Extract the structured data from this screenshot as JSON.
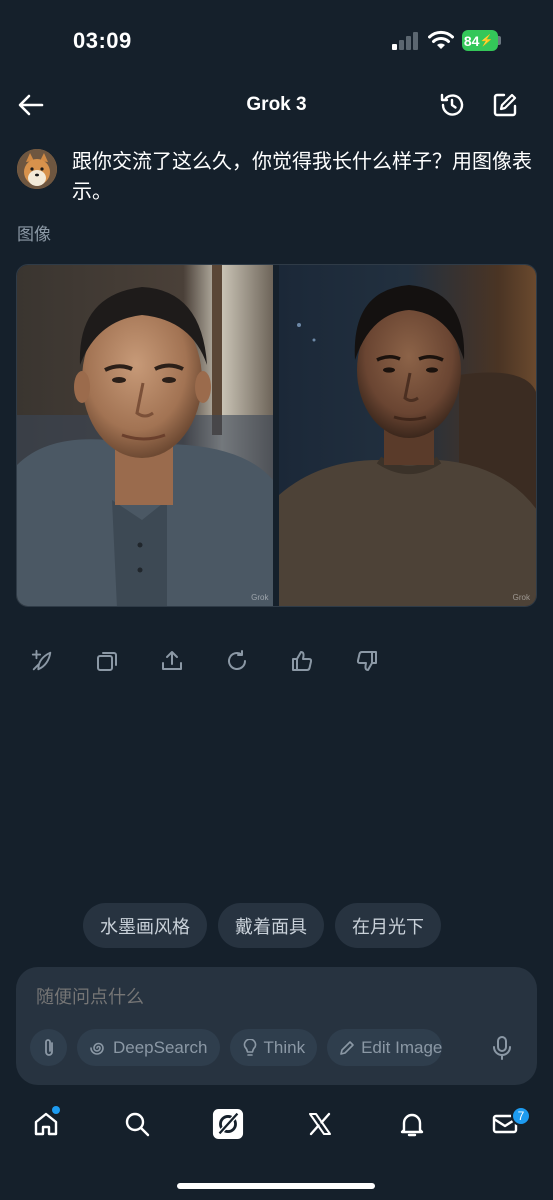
{
  "status_bar": {
    "time": "03:09",
    "battery": "84"
  },
  "header": {
    "title": "Grok 3"
  },
  "message": {
    "text": "跟你交流了这么久，你觉得我长什么样子？用图像表示。",
    "media_label": "图像",
    "images": [
      {
        "watermark": "Grok"
      },
      {
        "watermark": "Grok"
      }
    ]
  },
  "actions": [
    "regenerate-sparkle-icon",
    "copy-icon",
    "share-icon",
    "refresh-icon",
    "thumbs-up-icon",
    "thumbs-down-icon"
  ],
  "suggestions": [
    "水墨画风格",
    "戴着面具",
    "在月光下"
  ],
  "composer": {
    "placeholder": "随便问点什么",
    "tools": {
      "deepsearch": "DeepSearch",
      "think": "Think",
      "edit_image": "Edit Image"
    }
  },
  "bottom_nav": {
    "mail_badge": "7"
  },
  "colors": {
    "background": "#15202b",
    "surface": "#273340",
    "accent": "#1d9bf0",
    "battery": "#34c759"
  }
}
